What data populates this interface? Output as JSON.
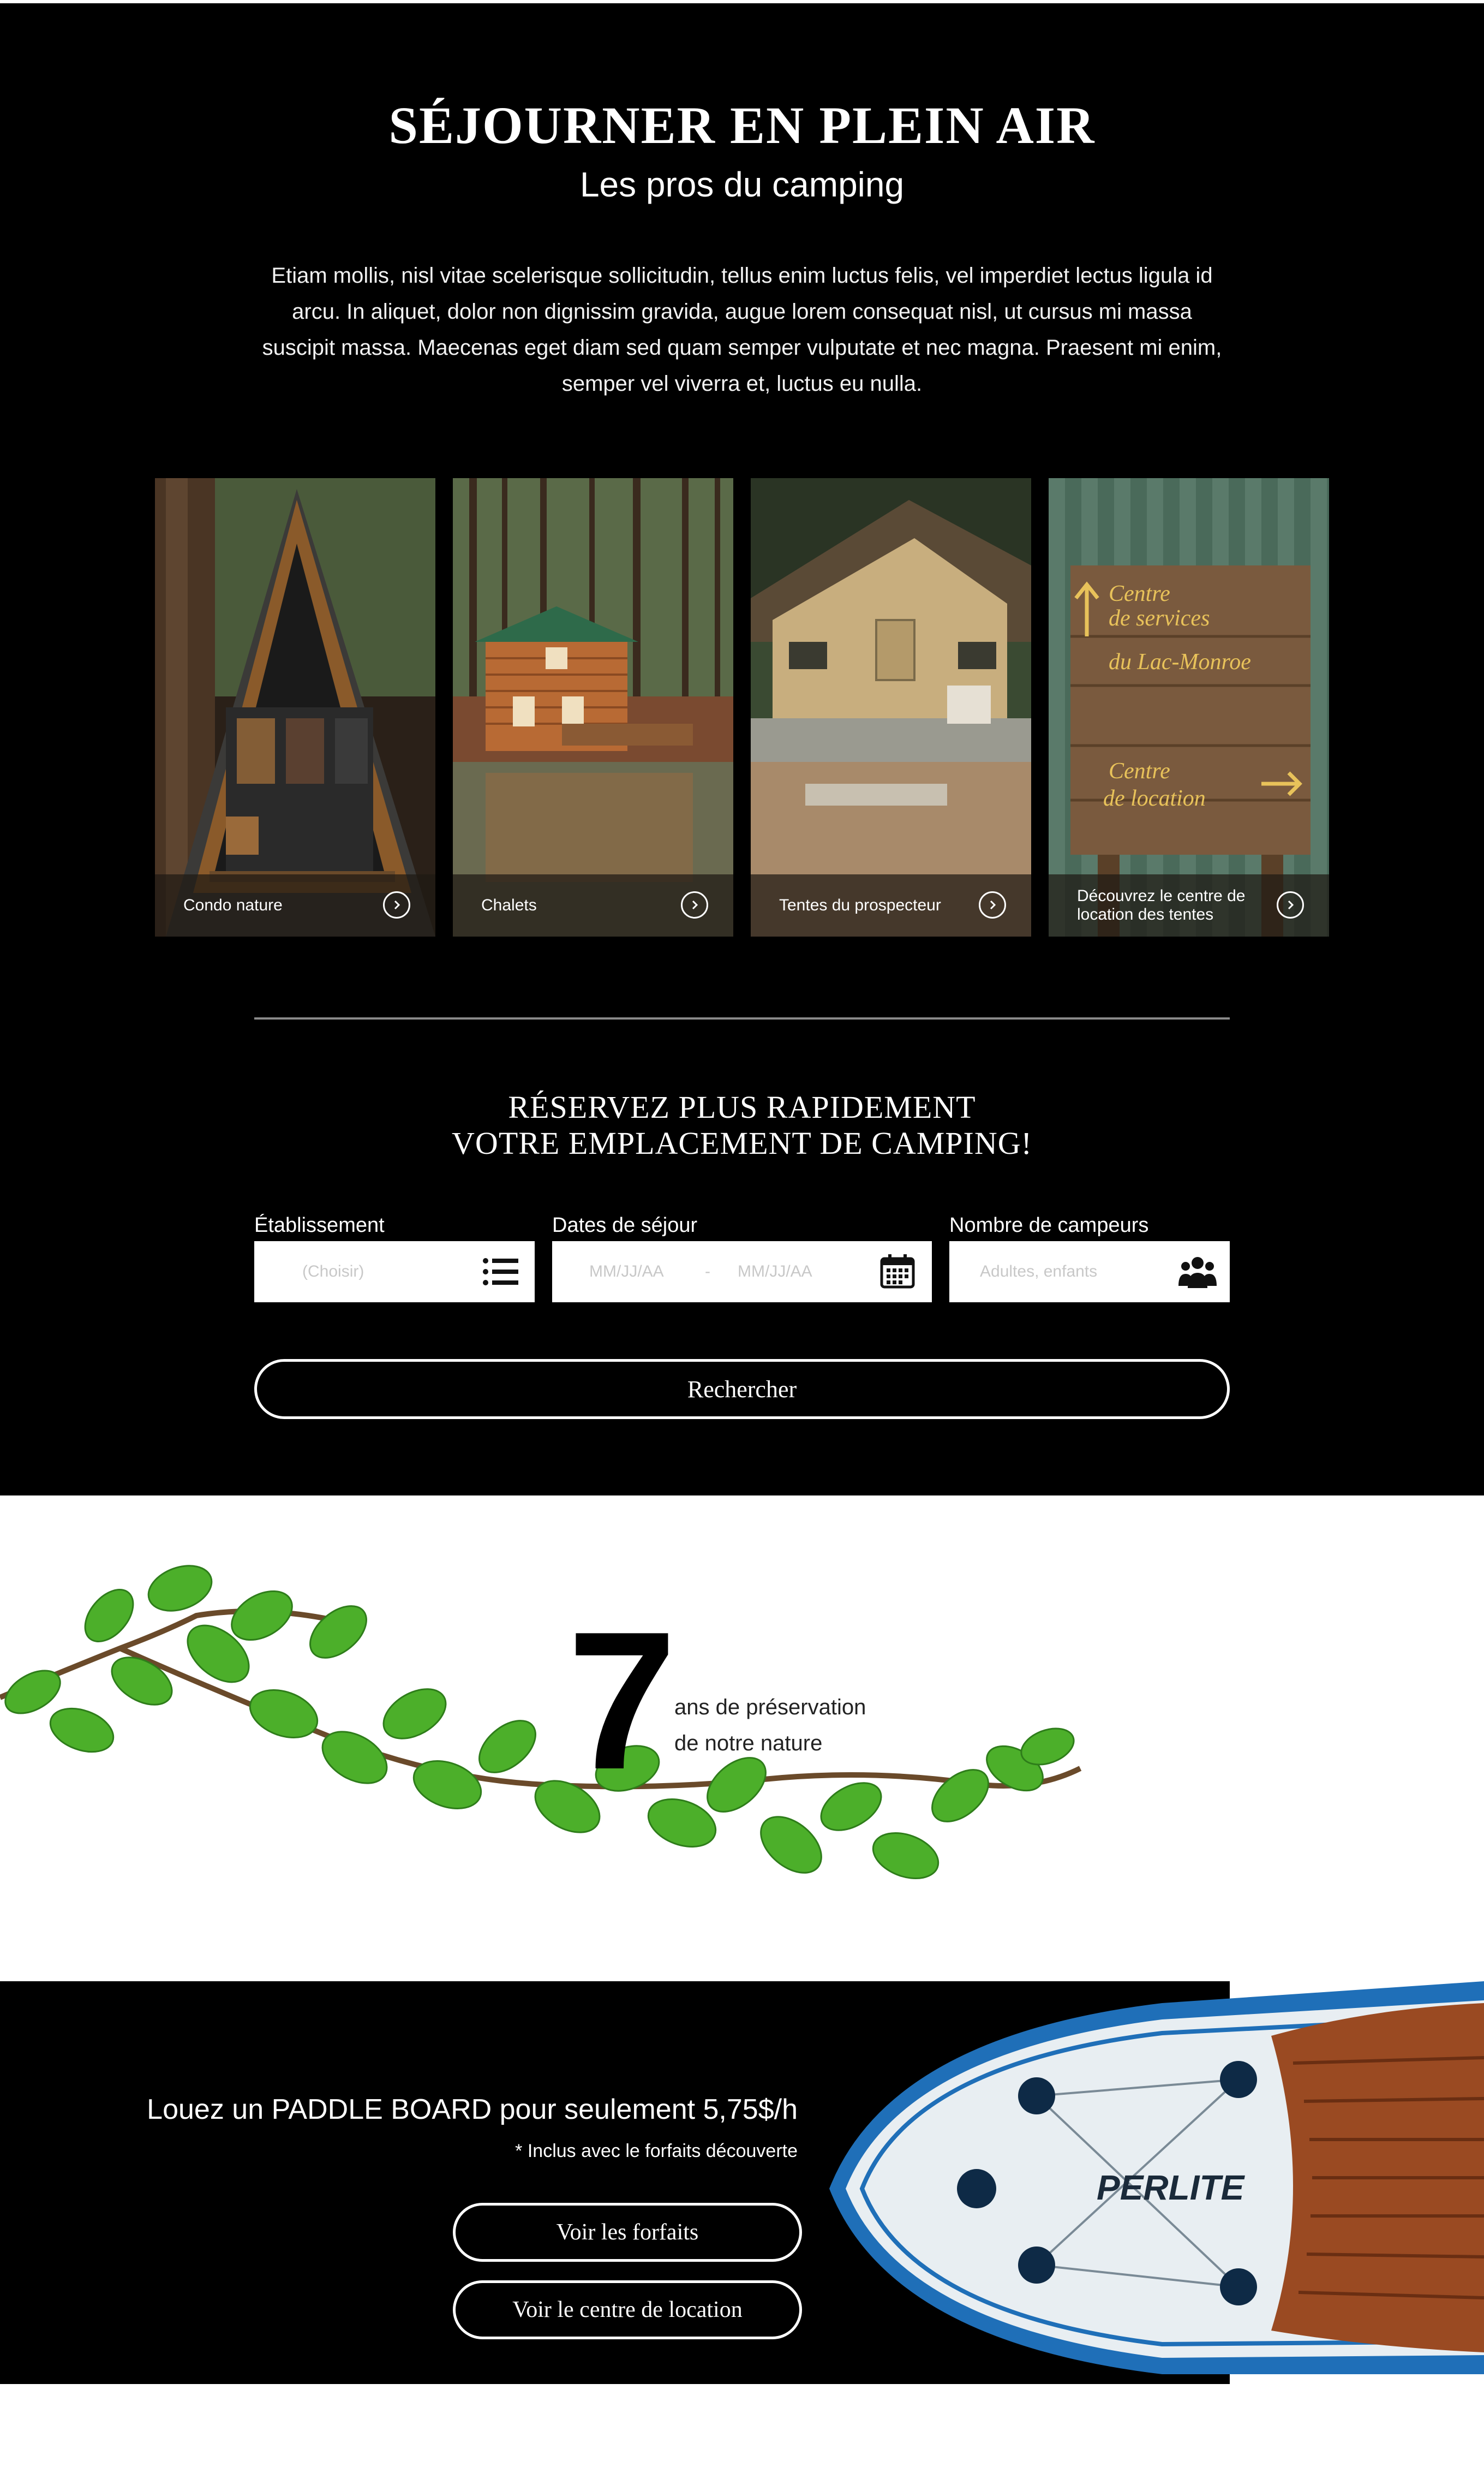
{
  "hero": {
    "title": "SÉJOURNER EN PLEIN AIR",
    "subtitle": "Les pros du camping",
    "body": "Etiam mollis, nisl vitae scelerisque sollicitudin, tellus enim luctus felis, vel imperdiet lectus ligula id arcu. In aliquet, dolor non dignissim gravida, augue lorem consequat nisl, ut cursus mi massa suscipit massa. Maecenas eget diam sed quam semper vulputate et nec magna. Praesent mi enim, semper vel viverra et, luctus eu nulla."
  },
  "cards": [
    {
      "label": "Condo nature",
      "icon": "chevron-right-circle-icon"
    },
    {
      "label": "Chalets",
      "icon": "chevron-right-circle-icon"
    },
    {
      "label": "Tentes du prospecteur",
      "icon": "chevron-right-circle-icon"
    },
    {
      "label": "Découvrez le centre de location des tentes",
      "icon": "chevron-right-circle-icon"
    }
  ],
  "sign": {
    "line1": "Centre",
    "line2": "de services",
    "line3": "du Lac-Monroe",
    "line4": "Centre",
    "line5": "de location"
  },
  "reserve": {
    "title_line1": "RÉSERVEZ PLUS RAPIDEMENT",
    "title_line2": "VOTRE EMPLACEMENT DE CAMPING!",
    "establishment_label": "Établissement",
    "establishment_placeholder": "(Choisir)",
    "dates_label": "Dates de séjour",
    "date_from_placeholder": "MM/JJ/AA",
    "date_separator": "-",
    "date_to_placeholder": "MM/JJ/AA",
    "campers_label": "Nombre de campeurs",
    "campers_placeholder": "Adultes, enfants",
    "search_label": "Rechercher"
  },
  "stat": {
    "number": "7",
    "line1": "ans de préservation",
    "line2": "de notre nature"
  },
  "paddle": {
    "title": "Louez un PADDLE BOARD pour seulement 5,75$/h",
    "note": "* Inclus avec le forfaits découverte",
    "button1": "Voir les forfaits",
    "button2": "Voir le centre de location",
    "board_brand": "PERLITE"
  },
  "colors": {
    "background_dark": "#000000",
    "text_light": "#ffffff",
    "leaf_green": "#4caf2a",
    "board_blue": "#1e6fb8",
    "wood": "#9a4a22"
  }
}
